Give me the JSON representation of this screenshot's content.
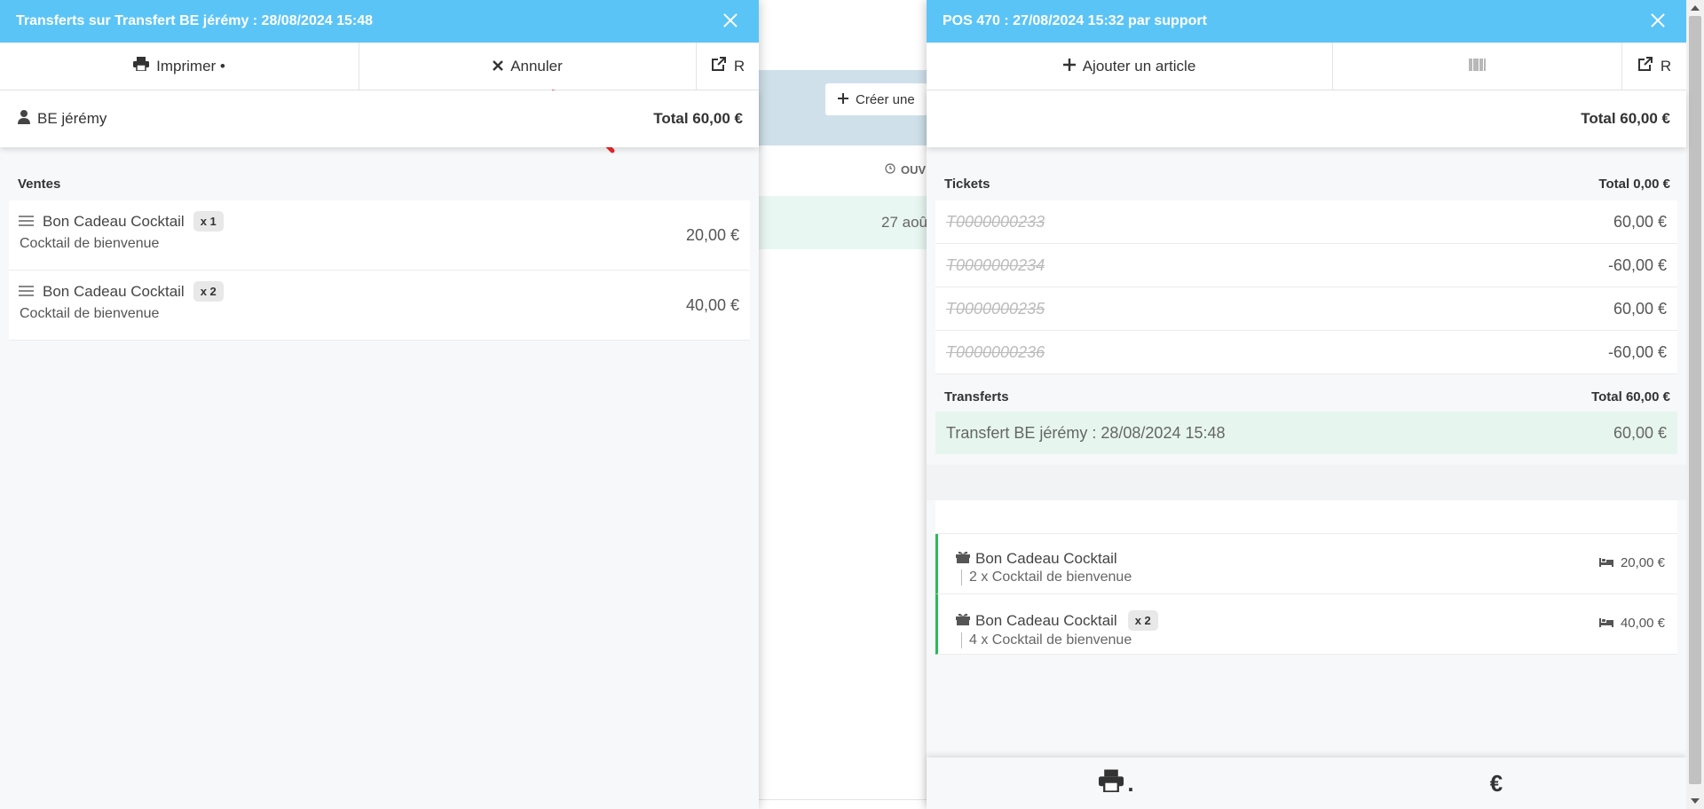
{
  "background": {
    "create_label": "Créer une",
    "col_head": "OUV",
    "row_text": "27 aoû"
  },
  "left": {
    "title": "Transferts sur Transfert BE jérémy : 28/08/2024 15:48",
    "toolbar": {
      "print_label": "Imprimer •",
      "cancel_label": "Annuler",
      "open_label": "R"
    },
    "customer": "BE jérémy",
    "total": "Total 60,00 €",
    "sales_heading": "Ventes",
    "items": [
      {
        "name": "Bon Cadeau Cocktail",
        "qty": "x 1",
        "sub": "Cocktail de bienvenue",
        "price": "20,00 €"
      },
      {
        "name": "Bon Cadeau Cocktail",
        "qty": "x 2",
        "sub": "Cocktail de bienvenue",
        "price": "40,00 €"
      }
    ]
  },
  "right": {
    "title": "POS 470 : 27/08/2024 15:32 par support",
    "toolbar": {
      "add_label": "Ajouter un article",
      "open_label": "R"
    },
    "total": "Total 60,00 €",
    "tickets_heading": "Tickets",
    "tickets_total": "Total 0,00 €",
    "tickets": [
      {
        "code": "T0000000233",
        "amount": "60,00 €"
      },
      {
        "code": "T0000000234",
        "amount": "-60,00 €"
      },
      {
        "code": "T0000000235",
        "amount": "60,00 €"
      },
      {
        "code": "T0000000236",
        "amount": "-60,00 €"
      }
    ],
    "transfers_heading": "Transferts",
    "transfers_total": "Total 60,00 €",
    "transfer": {
      "label": "Transfert BE jérémy : 28/08/2024 15:48",
      "amount": "60,00 €"
    },
    "orders": [
      {
        "name": "Bon Cadeau Cocktail",
        "qty": "",
        "sub": "2 x Cocktail de bienvenue",
        "price": "20,00 €"
      },
      {
        "name": "Bon Cadeau Cocktail",
        "qty": "x 2",
        "sub": "4 x Cocktail de bienvenue",
        "price": "40,00 €"
      }
    ],
    "bottom": {
      "print_suffix": ".",
      "euro": "€"
    }
  },
  "colors": {
    "title_bar": "#5bc4f7",
    "transfer_bg": "#e6f6ef",
    "accent_green": "#2db85c",
    "arrow": "#e8262a"
  }
}
